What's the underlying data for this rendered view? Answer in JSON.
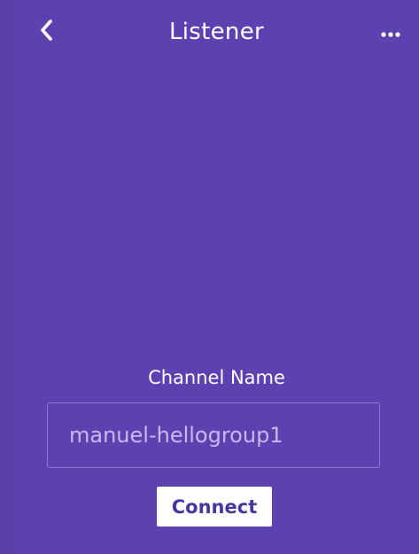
{
  "header": {
    "title": "Listener",
    "back_icon": "chevron-left-icon",
    "more_icon": "more-horizontal-icon"
  },
  "form": {
    "label": "Channel Name",
    "channel_value": "manuel-hellogroup1",
    "connect_label": "Connect"
  },
  "colors": {
    "background": "#5d41b0",
    "button_text": "#4a35a0",
    "input_text": "#c8b8f0"
  }
}
